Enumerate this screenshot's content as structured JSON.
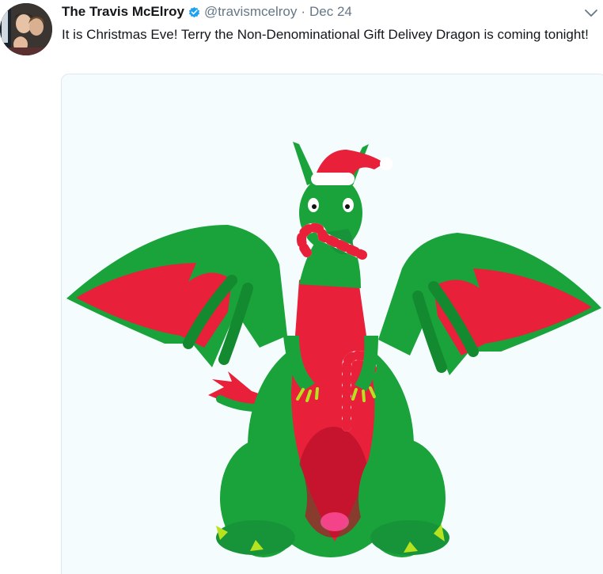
{
  "tweet": {
    "display_name": "The Travis McElroy",
    "verified": true,
    "handle": "@travismcelroy",
    "separator": "·",
    "date": "Dec 24",
    "text": "It is Christmas Eve! Terry the Non-Denominational Gift Delivey Dragon is coming tonight!"
  },
  "colors": {
    "name_text": "#14171a",
    "secondary_text": "#657786",
    "verified_blue": "#1da1f2",
    "dragon_green": "#1aa33a",
    "dragon_red": "#e8203a",
    "media_background": "#f5fcfd"
  },
  "icons": {
    "verified": "verified-badge-icon",
    "menu": "chevron-down-icon"
  }
}
